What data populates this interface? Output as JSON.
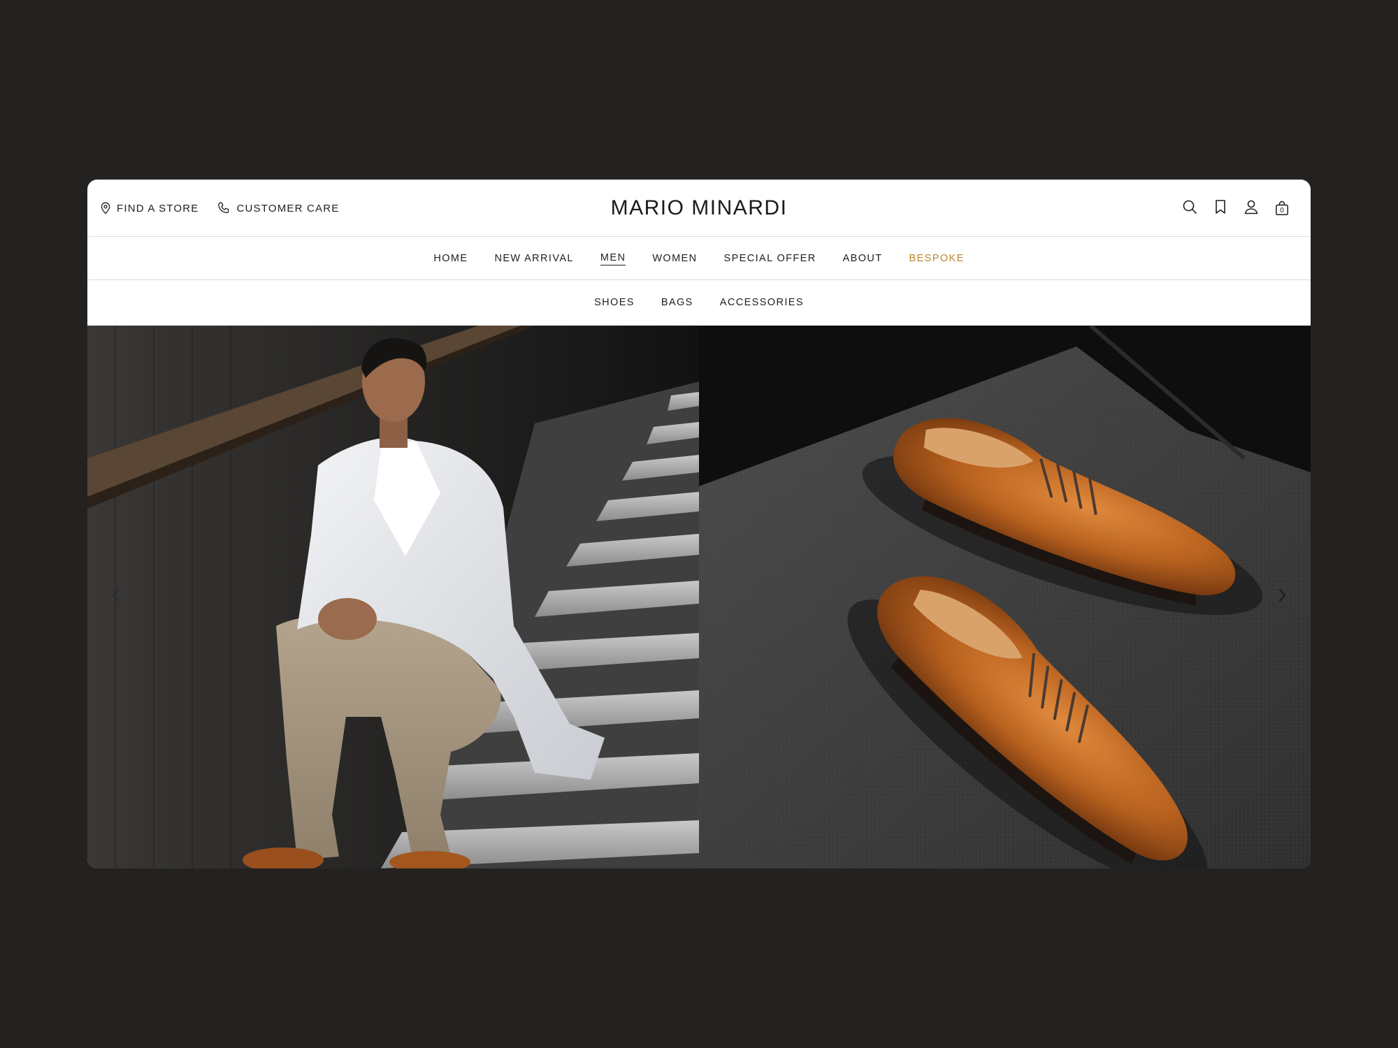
{
  "header": {
    "find_store": "FIND A STORE",
    "customer_care": "CUSTOMER CARE",
    "brand": "MARIO MINARDI",
    "cart_count": "0"
  },
  "nav": {
    "items": [
      "HOME",
      "NEW ARRIVAL",
      "MEN",
      "WOMEN",
      "SPECIAL OFFER",
      "ABOUT",
      "BESPOKE"
    ],
    "active": "MEN",
    "accent_item": "BESPOKE"
  },
  "subnav": {
    "items": [
      "SHOES",
      "BAGS",
      "ACCESSORIES"
    ]
  },
  "icons": {
    "left": [
      "location-pin-icon",
      "phone-icon"
    ],
    "right": [
      "search-icon",
      "bookmark-icon",
      "user-icon",
      "bag-icon"
    ],
    "carousel": [
      "chevron-left-icon",
      "chevron-right-icon"
    ]
  },
  "colors": {
    "background": "#232220",
    "text": "#1e1e1e",
    "accent": "#b8862b",
    "divider": "#dcdcdc"
  }
}
